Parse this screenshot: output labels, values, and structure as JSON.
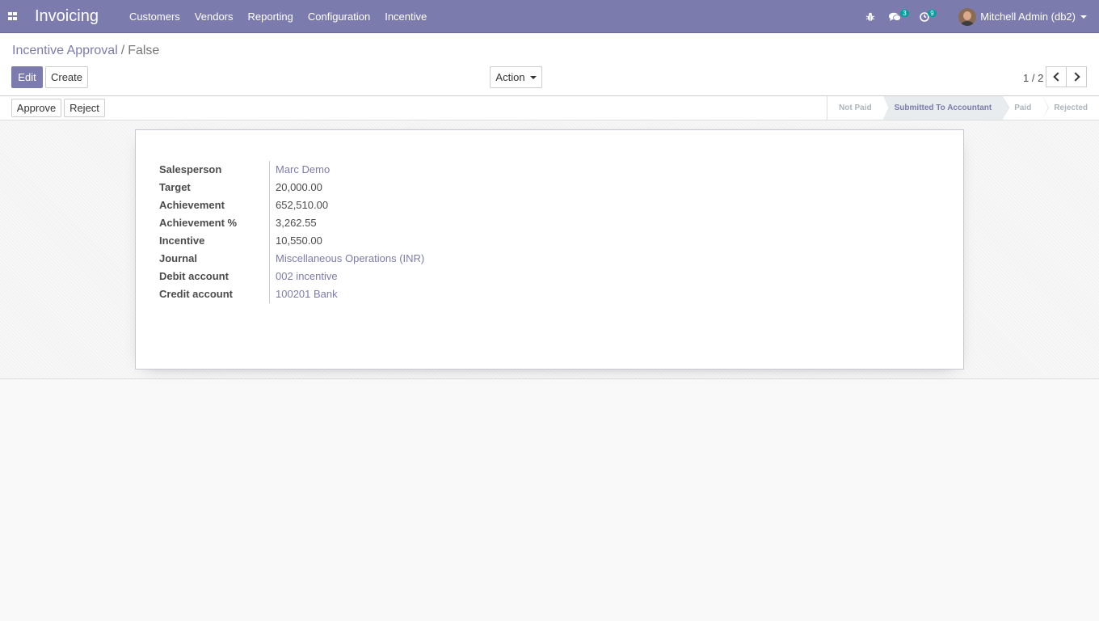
{
  "navbar": {
    "app_name": "Invoicing",
    "menu": [
      "Customers",
      "Vendors",
      "Reporting",
      "Configuration",
      "Incentive"
    ],
    "icons": [
      "bug-icon",
      "chat-icon",
      "clock-icon"
    ],
    "messages_count": "3",
    "activities_count": "9",
    "user_name": "Mitchell Admin (db2)"
  },
  "breadcrumb": {
    "parent": "Incentive Approval",
    "separator": "/",
    "current": "False"
  },
  "buttons": {
    "edit": "Edit",
    "create": "Create",
    "action": "Action",
    "approve": "Approve",
    "reject": "Reject"
  },
  "pager": {
    "value": "1 / 2"
  },
  "statusbar": {
    "stages": [
      "Not Paid",
      "Submitted To Accountant",
      "Paid",
      "Rejected"
    ],
    "current": "Submitted To Accountant"
  },
  "form": {
    "fields": [
      {
        "label": "Salesperson",
        "value": "Marc Demo"
      },
      {
        "label": "Target",
        "value": "20,000.00"
      },
      {
        "label": "Achievement",
        "value": "652,510.00"
      },
      {
        "label": "Achievement %",
        "value": "3,262.55"
      },
      {
        "label": "Incentive",
        "value": "10,550.00"
      },
      {
        "label": "Journal",
        "value": "Miscellaneous Operations (INR)"
      },
      {
        "label": "Debit account",
        "value": "002 incentive"
      },
      {
        "label": "Credit account",
        "value": "100201 Bank"
      }
    ]
  },
  "colors": {
    "brand": "#7c7bad",
    "badge": "#00a09d"
  }
}
